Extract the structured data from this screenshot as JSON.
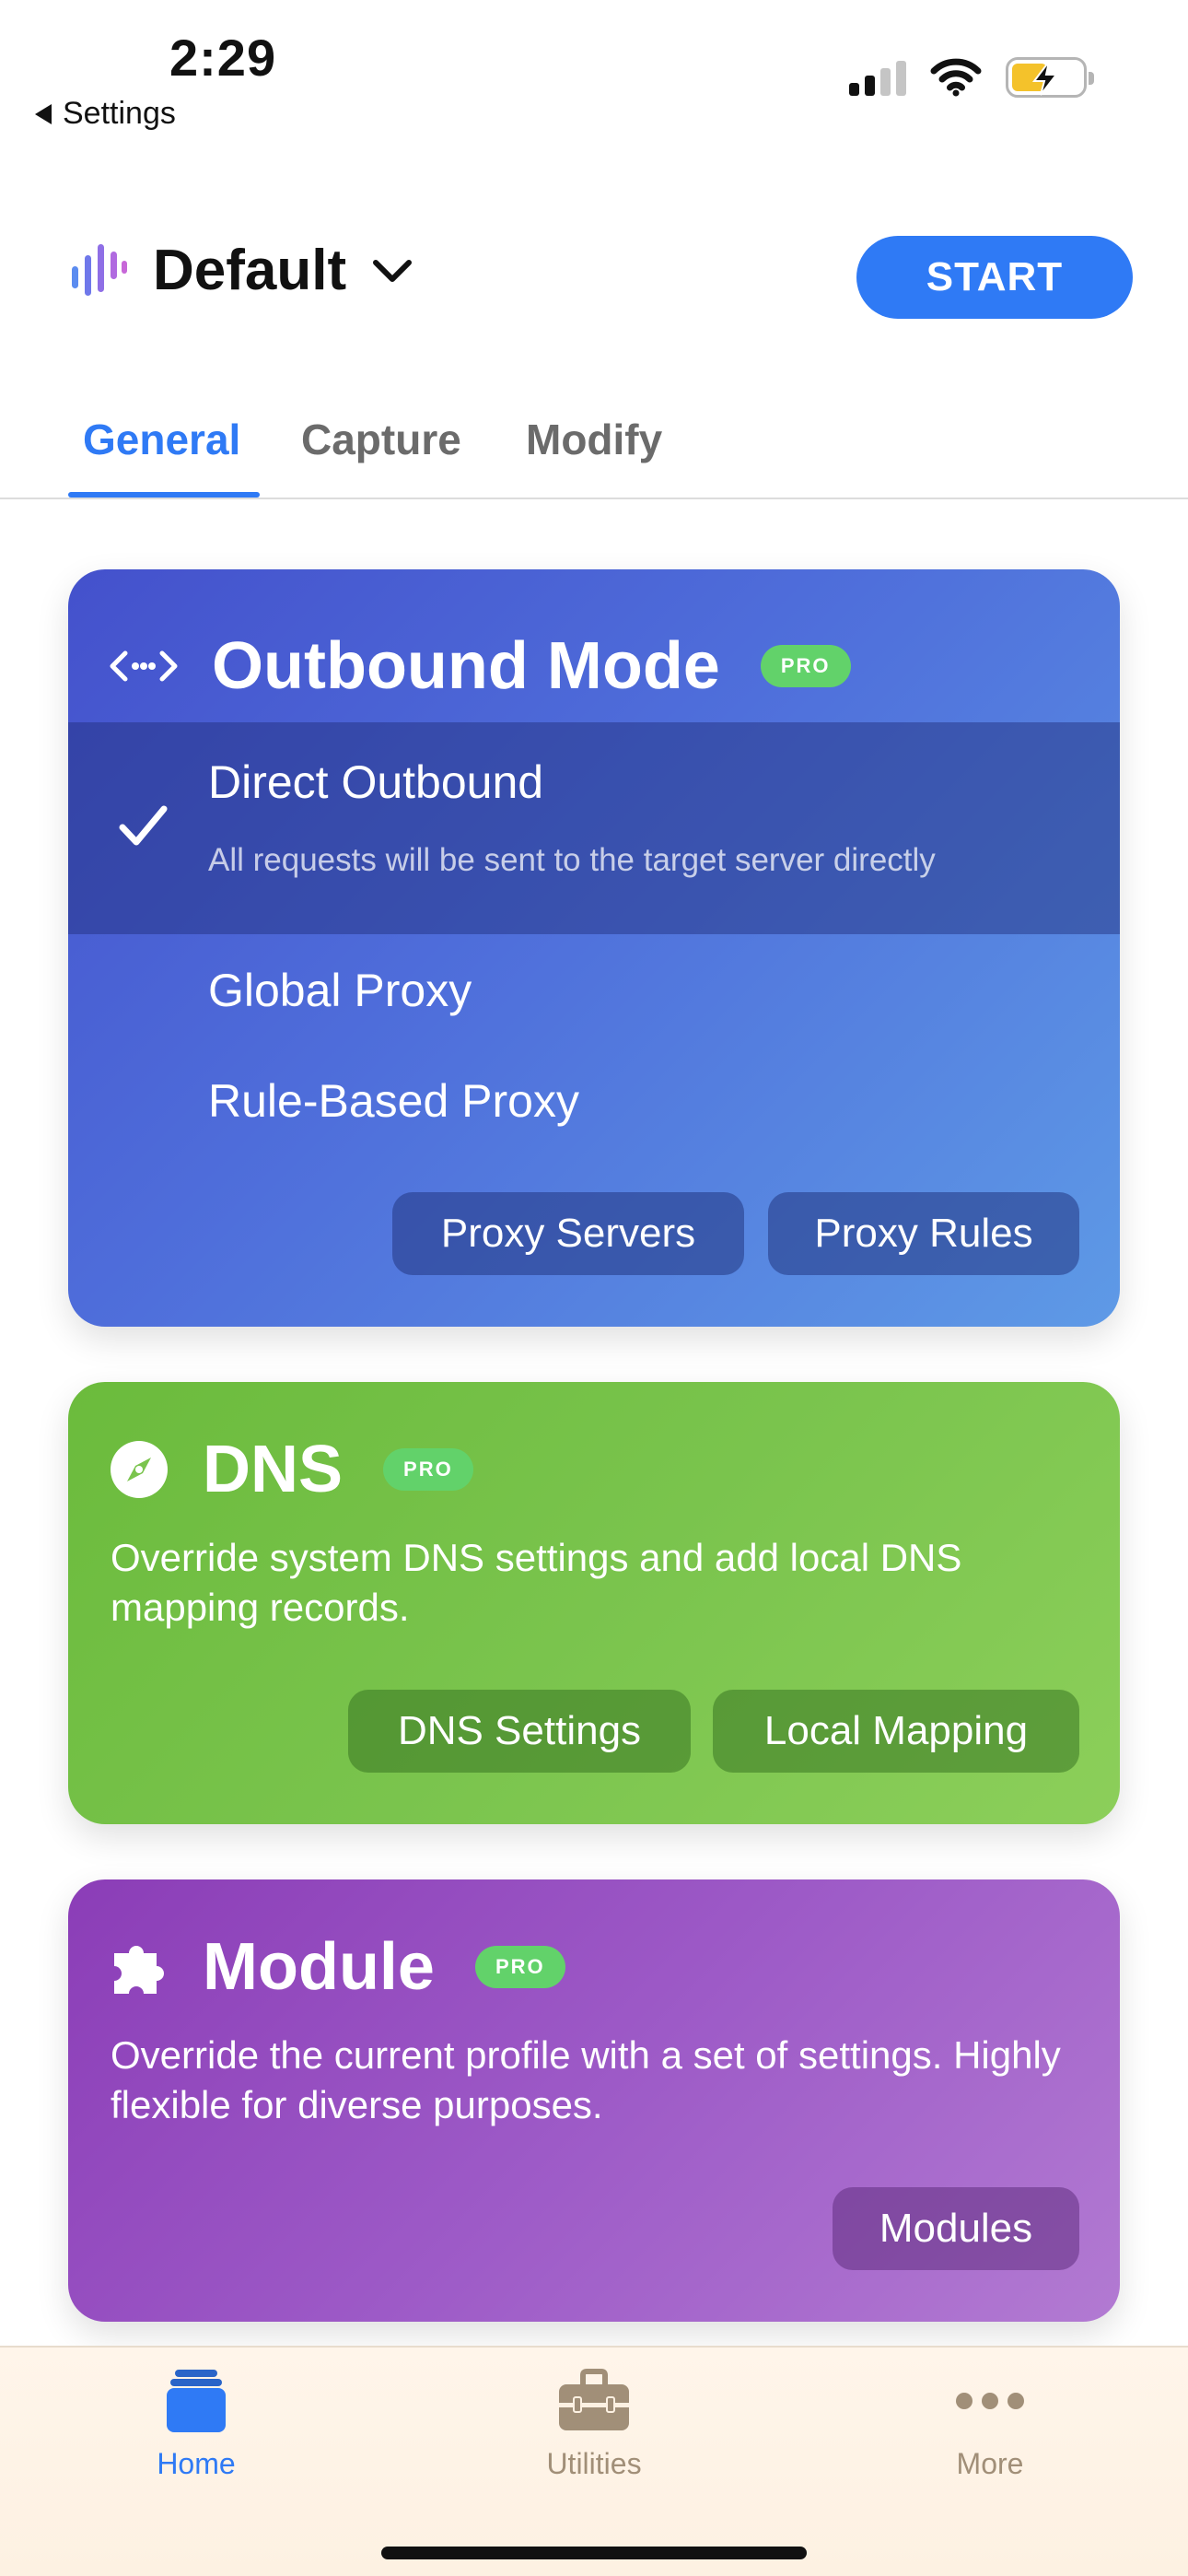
{
  "status_bar": {
    "time": "2:29",
    "back_label": "Settings"
  },
  "header": {
    "profile_name": "Default",
    "start_label": "START"
  },
  "tabs": [
    {
      "label": "General",
      "active": true
    },
    {
      "label": "Capture",
      "active": false
    },
    {
      "label": "Modify",
      "active": false
    }
  ],
  "outbound": {
    "title": "Outbound Mode",
    "badge": "PRO",
    "modes": [
      {
        "label": "Direct Outbound",
        "description": "All requests will be sent to the target server directly",
        "selected": true
      },
      {
        "label": "Global Proxy",
        "selected": false
      },
      {
        "label": "Rule-Based Proxy",
        "selected": false
      }
    ],
    "buttons": {
      "proxy_servers": "Proxy Servers",
      "proxy_rules": "Proxy Rules"
    }
  },
  "dns": {
    "title": "DNS",
    "badge": "PRO",
    "description": "Override system DNS settings and add local DNS mapping records.",
    "buttons": {
      "dns_settings": "DNS Settings",
      "local_mapping": "Local Mapping"
    }
  },
  "module": {
    "title": "Module",
    "badge": "PRO",
    "description": "Override the current profile with a set of settings. Highly flexible for diverse purposes.",
    "buttons": {
      "modules": "Modules"
    }
  },
  "tabbar": [
    {
      "label": "Home",
      "icon": "stack-icon",
      "active": true
    },
    {
      "label": "Utilities",
      "icon": "toolbox-icon",
      "active": false
    },
    {
      "label": "More",
      "icon": "ellipsis-icon",
      "active": false
    }
  ],
  "colors": {
    "accent": "#2f7af5",
    "pro_badge": "#62d26a",
    "outbound_card": "#4f6fdb",
    "dns_card": "#7ac44d",
    "module_card": "#9d5ac7"
  }
}
